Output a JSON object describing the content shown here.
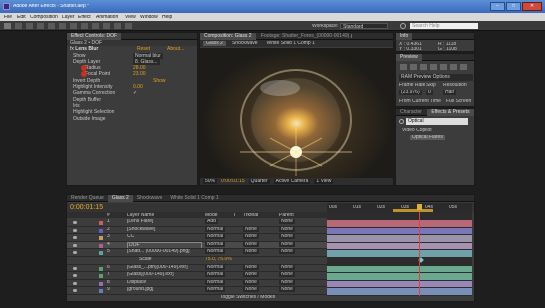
{
  "window": {
    "title": "Adobe After Effects - Shatter.aep *"
  },
  "menu": [
    "File",
    "Edit",
    "Composition",
    "Layer",
    "Effect",
    "Animation",
    "View",
    "Window",
    "Help"
  ],
  "toolbar": {
    "workspace_label": "Workspace:",
    "workspace_value": "Standard",
    "search_placeholder": "Search Help"
  },
  "effect_controls": {
    "tab": "Effect Controls: DOF",
    "header": "Glass 2 • DOF",
    "effect_name": "Lens Blur",
    "reset": "Reset",
    "about": "About...",
    "rows": [
      {
        "name": "Show",
        "value": "Normal blur"
      },
      {
        "name": "Depth Layer",
        "value": "8. Glass..."
      },
      {
        "name": "Radius",
        "value": "28.00"
      },
      {
        "name": "Focal Point",
        "value": "23.00"
      },
      {
        "name": "Invert Depth",
        "value": "Show"
      },
      {
        "name": "Highlight Intensity",
        "value": "0.00"
      },
      {
        "name": "Gamma Correction",
        "value": ""
      },
      {
        "name": "Depth Buffer",
        "value": ""
      },
      {
        "name": "Iris",
        "value": ""
      },
      {
        "name": "Highlight Selection",
        "value": ""
      },
      {
        "name": "Outside Image",
        "value": ""
      }
    ]
  },
  "composition": {
    "tab": "Composition: Glass 2",
    "tab2": "Footage: Shatter_Fores_(00000-00149).png",
    "subtabs": [
      "Glass 2",
      "Shockwave",
      "White Solid 1 Comp 1"
    ],
    "zoom": "50%",
    "time": "0:00:01:15",
    "resolution": "Quarter",
    "camera": "Active Camera",
    "views": "1 View"
  },
  "info": {
    "tab": "Info",
    "x": "X : 0.4361",
    "y": "Y : 0.3301",
    "r": "R : 1118",
    "g": "G : 1108",
    "b": "B :",
    "a": "A : 1"
  },
  "preview": {
    "tab": "Preview",
    "options": "RAM Preview Options",
    "frame_rate_label": "Frame Rate",
    "skip_label": "Skip",
    "resolution_label": "Resolution",
    "frame_rate": "(23.976)",
    "skip": "0",
    "resolution": "Half",
    "from_current": "From Current Time",
    "full_screen": "Full Screen"
  },
  "effects_presets": {
    "tab": "Effects & Presets",
    "tab2": "Character",
    "search": "Optical",
    "category": "Video Copilot",
    "item": "Optical Flares"
  },
  "timeline": {
    "tabs": [
      "Render Queue",
      "Glass 2",
      "Shockwave",
      "White Solid 1 Comp 1"
    ],
    "current_time": "0:00:01:15",
    "columns": [
      "#",
      "Layer Name",
      "Mode",
      "T",
      "TrkMat",
      "Parent"
    ],
    "layers": [
      {
        "num": "1",
        "name": "[Lens Flare]",
        "mode": "Add",
        "trkmat": "",
        "parent": "None",
        "color": "#c86060"
      },
      {
        "num": "2",
        "name": "[Shockwave]",
        "mode": "Normal",
        "trkmat": "None",
        "parent": "None",
        "color": "#6060c8"
      },
      {
        "num": "3",
        "name": "CC",
        "mode": "Normal",
        "trkmat": "None",
        "parent": "None",
        "color": "#c0a060"
      },
      {
        "num": "4",
        "name": "DOF",
        "mode": "Normal",
        "trkmat": "None",
        "parent": "None",
        "color": "#b06090"
      },
      {
        "num": "5",
        "name": "[Shatt... (00000-00149).png]",
        "mode": "Normal",
        "trkmat": "None",
        "parent": "None",
        "color": "#60a0a0"
      },
      {
        "num": "",
        "name": "Scale",
        "mode": "75.0, 75.0%",
        "trkmat": "",
        "parent": "",
        "color": ""
      },
      {
        "num": "6",
        "name": "[Glass_...pth](000-149].exr]",
        "mode": "Normal",
        "trkmat": "None",
        "parent": "None",
        "color": "#60a070"
      },
      {
        "num": "7",
        "name": "[Glass](000-149].exr]",
        "mode": "Normal",
        "trkmat": "None",
        "parent": "None",
        "color": "#60a070"
      },
      {
        "num": "8",
        "name": "Displace",
        "mode": "Normal",
        "trkmat": "None",
        "parent": "None",
        "color": "#9070b0"
      },
      {
        "num": "9",
        "name": "[ground.jpg]",
        "mode": "Normal",
        "trkmat": "None",
        "parent": "None",
        "color": "#6080b0"
      }
    ],
    "toggle": "Toggle Switches / Modes",
    "ruler": [
      "00s",
      "01s",
      "02s",
      "03s",
      "04s",
      "05s",
      "06s"
    ]
  }
}
